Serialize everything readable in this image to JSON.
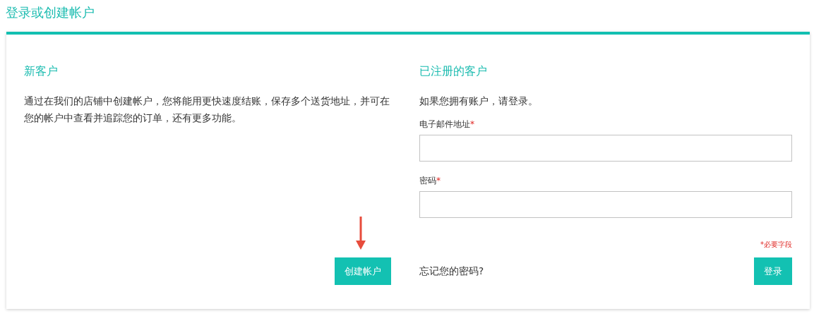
{
  "page_title": "登录或创建帐户",
  "new_customer": {
    "heading": "新客户",
    "text": "通过在我们的店铺中创建帐户，您将能用更快速度结账，保存多个送货地址，并可在您的帐户中查看并追踪您的订单，还有更多功能。",
    "button": "创建帐户"
  },
  "registered": {
    "heading": "已注册的客户",
    "intro": "如果您拥有账户，请登录。",
    "fields": [
      {
        "label": "电子邮件地址",
        "required_mark": "*"
      },
      {
        "label": "密码",
        "required_mark": "*"
      }
    ],
    "required_note": {
      "mark": "*",
      "text": "必要字段"
    },
    "forgot_link": "忘记您的密码?",
    "button": "登录"
  }
}
